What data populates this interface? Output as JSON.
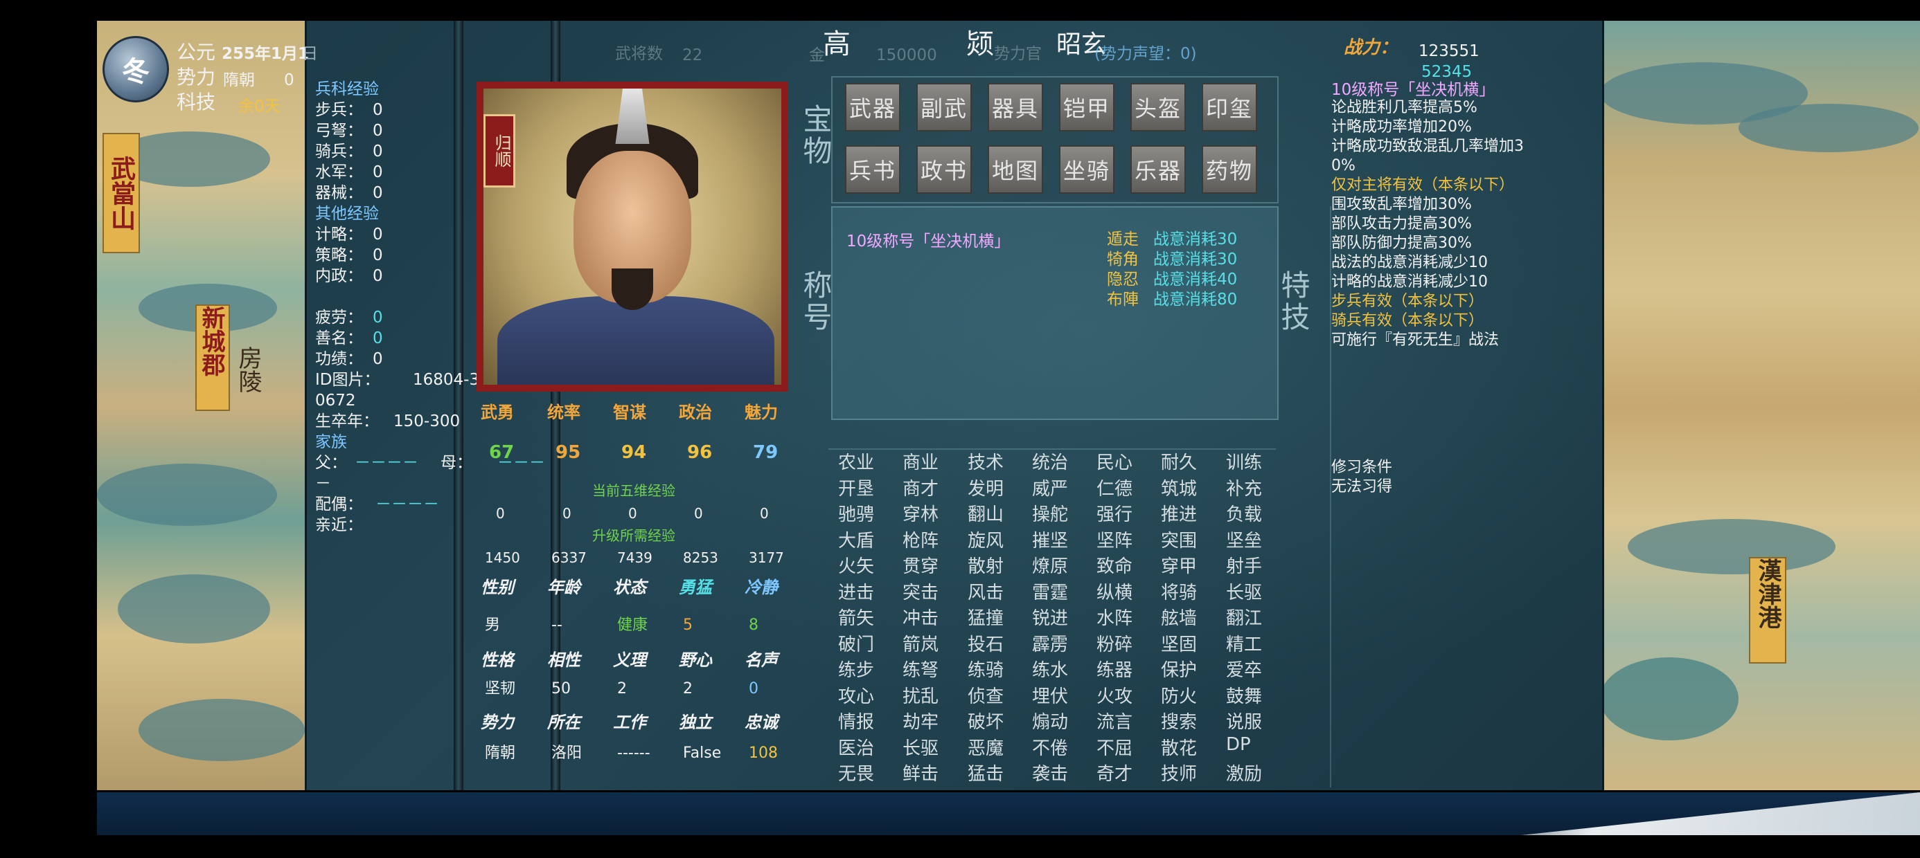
{
  "season": "冬",
  "calendar": {
    "era_label": "公元",
    "date": "255年1月1",
    "date_tail": "日",
    "force_label": "势力",
    "force_value": "隋朝",
    "force_num": "0",
    "tech_label": "科技",
    "tech_value": "余0天"
  },
  "map_labels": {
    "left1": "武當山",
    "left2": "新城郡",
    "left3": "房陵",
    "right1": "漢津港"
  },
  "header": {
    "name1": "高",
    "name2": "颎",
    "courtesy": "昭玄",
    "ghost1": "武将数",
    "ghost1_val": "22",
    "ghost2": "势力官",
    "ghost3": "(势力声望：0)",
    "ghost4": "金",
    "ghost5": "150000"
  },
  "combat": {
    "label": "战力：",
    "value": "123551",
    "sub": "52345"
  },
  "exp": {
    "troop_title": "兵科经验",
    "troops": [
      {
        "k": "步兵：",
        "v": "0"
      },
      {
        "k": "弓弩：",
        "v": "0"
      },
      {
        "k": "骑兵：",
        "v": "0"
      },
      {
        "k": "水军：",
        "v": "0"
      },
      {
        "k": "器械：",
        "v": "0"
      }
    ],
    "other_title": "其他经验",
    "others": [
      {
        "k": "计略：",
        "v": "0"
      },
      {
        "k": "策略：",
        "v": "0"
      },
      {
        "k": "内政：",
        "v": "0"
      }
    ]
  },
  "status": {
    "fatigue_k": "疲劳：",
    "fatigue_v": "0",
    "fame_k": "善名：",
    "fame_v": "0",
    "merit_k": "功绩：",
    "merit_v": "0",
    "id_k": "ID图片：",
    "id_v": "16804-3",
    "id_v2": "0672",
    "life_k": "生卒年：",
    "life_v": "150-300",
    "family_k": "家族",
    "father_k": "父：",
    "father_v": "－－－－",
    "mother_k": "母：",
    "mother_v": "－－－",
    "dash": "－",
    "spouse_k": "配偶：",
    "spouse_v": "－－－－",
    "kin_k": "亲近："
  },
  "portrait_tag": "归顺",
  "attrs": {
    "headers": [
      "武勇",
      "统率",
      "智谋",
      "政治",
      "魅力"
    ],
    "values": [
      "67",
      "95",
      "94",
      "96",
      "79"
    ],
    "cur_exp_label": "当前五维经验",
    "cur_exp": [
      "0",
      "0",
      "0",
      "0",
      "0"
    ],
    "up_exp_label": "升级所需经验",
    "up_exp": [
      "1450",
      "6337",
      "7439",
      "8253",
      "3177"
    ]
  },
  "profile": {
    "row1_h": [
      "性别",
      "年龄",
      "状态",
      "勇猛",
      "冷静"
    ],
    "row1_v": [
      "男",
      "--",
      "健康",
      "5",
      "8"
    ],
    "row2_h": [
      "性格",
      "相性",
      "义理",
      "野心",
      "名声"
    ],
    "row2_v": [
      "坚韧",
      "50",
      "2",
      "2",
      "0"
    ],
    "row3_h": [
      "势力",
      "所在",
      "工作",
      "独立",
      "忠诚"
    ],
    "row3_v": [
      "隋朝",
      "洛阳",
      "------",
      "False",
      "108"
    ]
  },
  "treasure": {
    "label": "宝物",
    "row1": [
      "武器",
      "副武",
      "器具",
      "铠甲",
      "头盔",
      "印玺"
    ],
    "row2": [
      "兵书",
      "政书",
      "地图",
      "坐骑",
      "乐器",
      "药物"
    ]
  },
  "title_box": {
    "label": "称号",
    "title": "10级称号「坐决机横」",
    "tactics": [
      {
        "k": "遁走",
        "v": "战意消耗30"
      },
      {
        "k": "犄角",
        "v": "战意消耗30"
      },
      {
        "k": "隐忍",
        "v": "战意消耗40"
      },
      {
        "k": "布陣",
        "v": "战意消耗80"
      }
    ]
  },
  "special_label": "特技",
  "skills": [
    [
      "农业",
      "商业",
      "技术",
      "统治",
      "民心",
      "耐久",
      "训练"
    ],
    [
      "开垦",
      "商才",
      "发明",
      "威严",
      "仁德",
      "筑城",
      "补充"
    ],
    [
      "驰骋",
      "穿林",
      "翻山",
      "操舵",
      "强行",
      "推进",
      "负载"
    ],
    [
      "大盾",
      "枪阵",
      "旋风",
      "摧坚",
      "坚阵",
      "突围",
      "坚垒"
    ],
    [
      "火矢",
      "贯穿",
      "散射",
      "燎原",
      "致命",
      "穿甲",
      "射手"
    ],
    [
      "进击",
      "突击",
      "风击",
      "雷霆",
      "纵横",
      "将骑",
      "长驱"
    ],
    [
      "箭矢",
      "冲击",
      "猛撞",
      "锐进",
      "水阵",
      "舷墙",
      "翻江"
    ],
    [
      "破门",
      "箭岚",
      "投石",
      "霹雳",
      "粉碎",
      "坚固",
      "精工"
    ],
    [
      "练步",
      "练弩",
      "练骑",
      "练水",
      "练器",
      "保护",
      "爱卒"
    ],
    [
      "攻心",
      "扰乱",
      "侦查",
      "埋伏",
      "火攻",
      "防火",
      "鼓舞"
    ],
    [
      "情报",
      "劫牢",
      "破坏",
      "煽动",
      "流言",
      "搜索",
      "说服"
    ],
    [
      "医治",
      "长驱",
      "恶魔",
      "不倦",
      "不屈",
      "散花",
      "DP"
    ],
    [
      "无畏",
      "鲜击",
      "猛击",
      "袭击",
      "奇才",
      "技师",
      "激励"
    ]
  ],
  "right_info": {
    "title": "10级称号「坐决机横」",
    "lines": [
      "论战胜利几率提高5%",
      "计略成功率增加20%",
      "计略成功致敌混乱几率增加3",
      "0%"
    ],
    "only_main": "仅对主将有效（本条以下）",
    "lines2": [
      "围攻致乱率增加30%",
      "部队攻击力提高30%",
      "部队防御力提高30%",
      "战法的战意消耗减少10",
      "计略的战意消耗减少10"
    ],
    "infantry": "步兵有效（本条以下）",
    "cavalry": "骑兵有效（本条以下）",
    "can_use": "可施行『有死无生』战法",
    "learn_k": "修习条件",
    "learn_v": "无法习得"
  }
}
